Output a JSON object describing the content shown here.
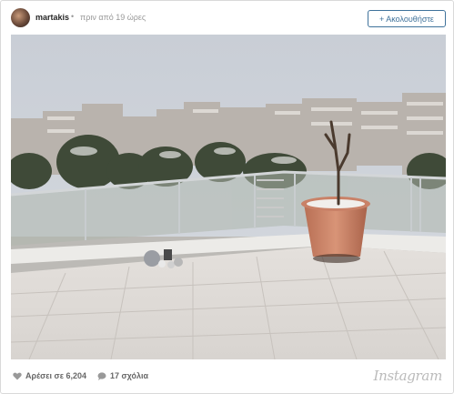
{
  "post": {
    "username": "martakis",
    "separator": "•",
    "time_ago": "πριν από 19 ώρες",
    "follow_label": "+ Ακολουθήστε"
  },
  "photo": {
    "alt": "Snowy balcony view with potted plant"
  },
  "footer": {
    "likes": "Αρέσει σε 6,204",
    "comments": "17 σχόλια",
    "brand": "Instagram"
  },
  "icons": {
    "like": "heart-icon",
    "comment": "comment-bubble-icon"
  }
}
